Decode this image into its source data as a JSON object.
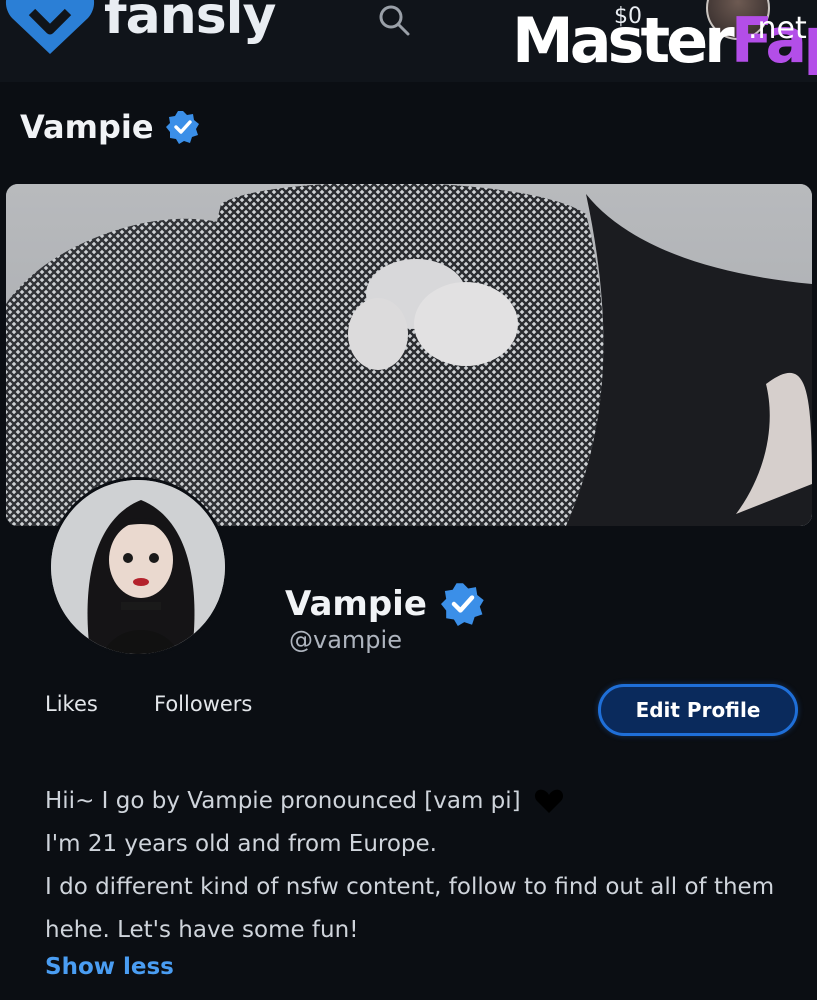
{
  "brand": {
    "name": "fansly"
  },
  "topbar": {
    "balance": "$0"
  },
  "watermark": {
    "part1": "Master",
    "part2": "Fap",
    "suffix": ".net"
  },
  "header": {
    "name": "Vampie"
  },
  "profile": {
    "display_name": "Vampie",
    "handle": "@vampie",
    "verified": true
  },
  "stats": {
    "likes_label": "Likes",
    "followers_label": "Followers"
  },
  "actions": {
    "edit_profile": "Edit Profile"
  },
  "bio": {
    "line1": "Hii~ I go by Vampie pronounced [vam pi]",
    "line2": "I'm 21 years old and from Europe.",
    "line3": "I do different kind of nsfw content, follow to find out all of them",
    "line4": "hehe. Let's have some fun!",
    "show_less": "Show less"
  },
  "colors": {
    "background": "#0b0e13",
    "accent": "#4a9df2",
    "verified": "#3b8fe8",
    "button_border": "#1f6fd8"
  },
  "icons": [
    "fansly-heart-logo-icon",
    "search-icon",
    "verified-badge-icon",
    "black-heart-icon"
  ]
}
